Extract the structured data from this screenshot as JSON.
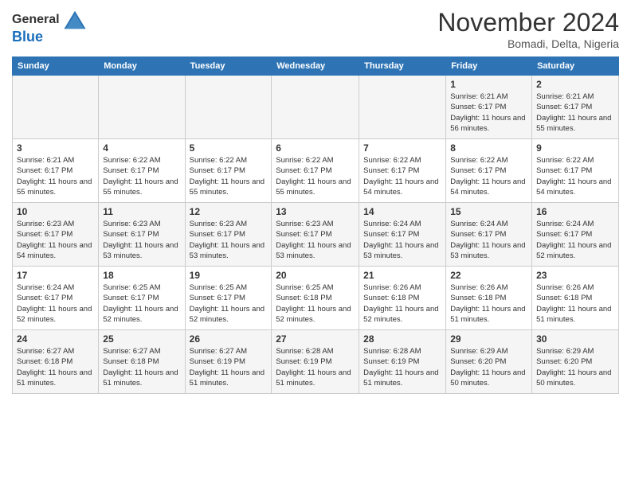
{
  "logo": {
    "general": "General",
    "blue": "Blue"
  },
  "title": "November 2024",
  "location": "Bomadi, Delta, Nigeria",
  "days_header": [
    "Sunday",
    "Monday",
    "Tuesday",
    "Wednesday",
    "Thursday",
    "Friday",
    "Saturday"
  ],
  "weeks": [
    [
      {
        "day": "",
        "info": ""
      },
      {
        "day": "",
        "info": ""
      },
      {
        "day": "",
        "info": ""
      },
      {
        "day": "",
        "info": ""
      },
      {
        "day": "",
        "info": ""
      },
      {
        "day": "1",
        "info": "Sunrise: 6:21 AM\nSunset: 6:17 PM\nDaylight: 11 hours and 56 minutes."
      },
      {
        "day": "2",
        "info": "Sunrise: 6:21 AM\nSunset: 6:17 PM\nDaylight: 11 hours and 55 minutes."
      }
    ],
    [
      {
        "day": "3",
        "info": "Sunrise: 6:21 AM\nSunset: 6:17 PM\nDaylight: 11 hours and 55 minutes."
      },
      {
        "day": "4",
        "info": "Sunrise: 6:22 AM\nSunset: 6:17 PM\nDaylight: 11 hours and 55 minutes."
      },
      {
        "day": "5",
        "info": "Sunrise: 6:22 AM\nSunset: 6:17 PM\nDaylight: 11 hours and 55 minutes."
      },
      {
        "day": "6",
        "info": "Sunrise: 6:22 AM\nSunset: 6:17 PM\nDaylight: 11 hours and 55 minutes."
      },
      {
        "day": "7",
        "info": "Sunrise: 6:22 AM\nSunset: 6:17 PM\nDaylight: 11 hours and 54 minutes."
      },
      {
        "day": "8",
        "info": "Sunrise: 6:22 AM\nSunset: 6:17 PM\nDaylight: 11 hours and 54 minutes."
      },
      {
        "day": "9",
        "info": "Sunrise: 6:22 AM\nSunset: 6:17 PM\nDaylight: 11 hours and 54 minutes."
      }
    ],
    [
      {
        "day": "10",
        "info": "Sunrise: 6:23 AM\nSunset: 6:17 PM\nDaylight: 11 hours and 54 minutes."
      },
      {
        "day": "11",
        "info": "Sunrise: 6:23 AM\nSunset: 6:17 PM\nDaylight: 11 hours and 53 minutes."
      },
      {
        "day": "12",
        "info": "Sunrise: 6:23 AM\nSunset: 6:17 PM\nDaylight: 11 hours and 53 minutes."
      },
      {
        "day": "13",
        "info": "Sunrise: 6:23 AM\nSunset: 6:17 PM\nDaylight: 11 hours and 53 minutes."
      },
      {
        "day": "14",
        "info": "Sunrise: 6:24 AM\nSunset: 6:17 PM\nDaylight: 11 hours and 53 minutes."
      },
      {
        "day": "15",
        "info": "Sunrise: 6:24 AM\nSunset: 6:17 PM\nDaylight: 11 hours and 53 minutes."
      },
      {
        "day": "16",
        "info": "Sunrise: 6:24 AM\nSunset: 6:17 PM\nDaylight: 11 hours and 52 minutes."
      }
    ],
    [
      {
        "day": "17",
        "info": "Sunrise: 6:24 AM\nSunset: 6:17 PM\nDaylight: 11 hours and 52 minutes."
      },
      {
        "day": "18",
        "info": "Sunrise: 6:25 AM\nSunset: 6:17 PM\nDaylight: 11 hours and 52 minutes."
      },
      {
        "day": "19",
        "info": "Sunrise: 6:25 AM\nSunset: 6:17 PM\nDaylight: 11 hours and 52 minutes."
      },
      {
        "day": "20",
        "info": "Sunrise: 6:25 AM\nSunset: 6:18 PM\nDaylight: 11 hours and 52 minutes."
      },
      {
        "day": "21",
        "info": "Sunrise: 6:26 AM\nSunset: 6:18 PM\nDaylight: 11 hours and 52 minutes."
      },
      {
        "day": "22",
        "info": "Sunrise: 6:26 AM\nSunset: 6:18 PM\nDaylight: 11 hours and 51 minutes."
      },
      {
        "day": "23",
        "info": "Sunrise: 6:26 AM\nSunset: 6:18 PM\nDaylight: 11 hours and 51 minutes."
      }
    ],
    [
      {
        "day": "24",
        "info": "Sunrise: 6:27 AM\nSunset: 6:18 PM\nDaylight: 11 hours and 51 minutes."
      },
      {
        "day": "25",
        "info": "Sunrise: 6:27 AM\nSunset: 6:18 PM\nDaylight: 11 hours and 51 minutes."
      },
      {
        "day": "26",
        "info": "Sunrise: 6:27 AM\nSunset: 6:19 PM\nDaylight: 11 hours and 51 minutes."
      },
      {
        "day": "27",
        "info": "Sunrise: 6:28 AM\nSunset: 6:19 PM\nDaylight: 11 hours and 51 minutes."
      },
      {
        "day": "28",
        "info": "Sunrise: 6:28 AM\nSunset: 6:19 PM\nDaylight: 11 hours and 51 minutes."
      },
      {
        "day": "29",
        "info": "Sunrise: 6:29 AM\nSunset: 6:20 PM\nDaylight: 11 hours and 50 minutes."
      },
      {
        "day": "30",
        "info": "Sunrise: 6:29 AM\nSunset: 6:20 PM\nDaylight: 11 hours and 50 minutes."
      }
    ]
  ]
}
